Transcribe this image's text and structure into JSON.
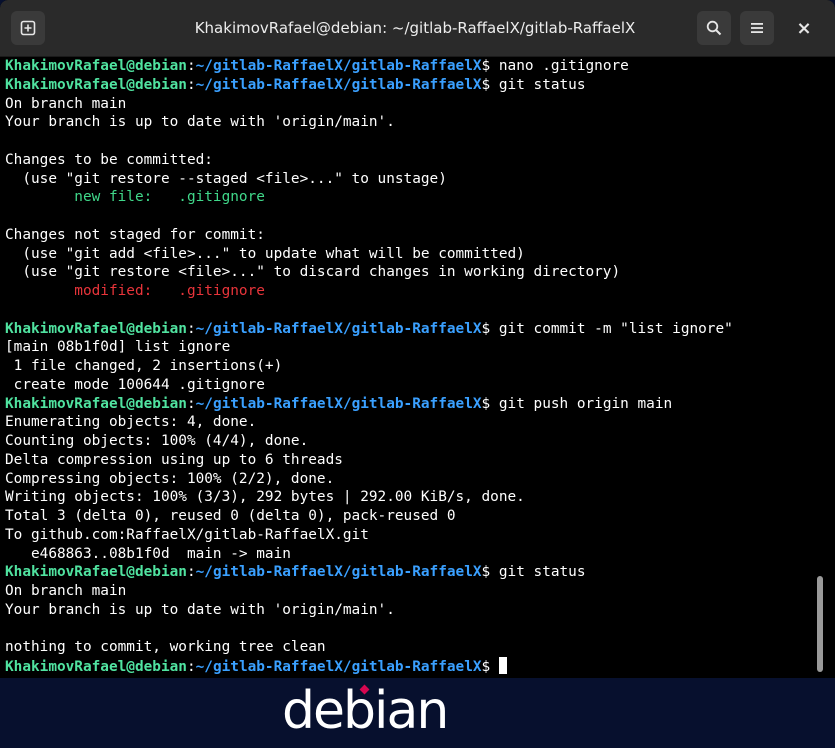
{
  "window": {
    "title": "KhakimovRafael@debian: ~/gitlab-RaffaelX/gitlab-RaffaelX",
    "buttons": {
      "close_glyph": "×"
    }
  },
  "prompt": {
    "user": "KhakimovRafael@debian",
    "sep": ":",
    "path": "~/gitlab-RaffaelX/gitlab-RaffaelX",
    "sign": "$ "
  },
  "terminal": {
    "lines": [
      {
        "type": "cmd",
        "text": "nano .gitignore"
      },
      {
        "type": "cmd",
        "text": "git status"
      },
      {
        "type": "out",
        "text": "On branch main"
      },
      {
        "type": "out",
        "text": "Your branch is up to date with 'origin/main'."
      },
      {
        "type": "out",
        "text": ""
      },
      {
        "type": "out",
        "text": "Changes to be committed:"
      },
      {
        "type": "out",
        "text": "  (use \"git restore --staged <file>...\" to unstage)"
      },
      {
        "type": "green",
        "text": "        new file:   .gitignore"
      },
      {
        "type": "out",
        "text": ""
      },
      {
        "type": "out",
        "text": "Changes not staged for commit:"
      },
      {
        "type": "out",
        "text": "  (use \"git add <file>...\" to update what will be committed)"
      },
      {
        "type": "out",
        "text": "  (use \"git restore <file>...\" to discard changes in working directory)"
      },
      {
        "type": "red",
        "text": "        modified:   .gitignore"
      },
      {
        "type": "out",
        "text": ""
      },
      {
        "type": "cmd",
        "text": "git commit -m \"list ignore\""
      },
      {
        "type": "out",
        "text": "[main 08b1f0d] list ignore"
      },
      {
        "type": "out",
        "text": " 1 file changed, 2 insertions(+)"
      },
      {
        "type": "out",
        "text": " create mode 100644 .gitignore"
      },
      {
        "type": "cmd",
        "text": "git push origin main"
      },
      {
        "type": "out",
        "text": "Enumerating objects: 4, done."
      },
      {
        "type": "out",
        "text": "Counting objects: 100% (4/4), done."
      },
      {
        "type": "out",
        "text": "Delta compression using up to 6 threads"
      },
      {
        "type": "out",
        "text": "Compressing objects: 100% (2/2), done."
      },
      {
        "type": "out",
        "text": "Writing objects: 100% (3/3), 292 bytes | 292.00 KiB/s, done."
      },
      {
        "type": "out",
        "text": "Total 3 (delta 0), reused 0 (delta 0), pack-reused 0"
      },
      {
        "type": "out",
        "text": "To github.com:RaffaelX/gitlab-RaffaelX.git"
      },
      {
        "type": "out",
        "text": "   e468863..08b1f0d  main -> main"
      },
      {
        "type": "cmd",
        "text": "git status"
      },
      {
        "type": "out",
        "text": "On branch main"
      },
      {
        "type": "out",
        "text": "Your branch is up to date with 'origin/main'."
      },
      {
        "type": "out",
        "text": ""
      },
      {
        "type": "out",
        "text": "nothing to commit, working tree clean"
      },
      {
        "type": "prompt",
        "text": ""
      }
    ]
  },
  "desktop": {
    "logo_text": "debian"
  },
  "colors": {
    "prompt_user": "#50e3a0",
    "prompt_path": "#3aa0ff",
    "staged": "#40d88a",
    "modified": "#e8343a",
    "desktop_bg": "#07102e",
    "logo_accent": "#d70751"
  }
}
